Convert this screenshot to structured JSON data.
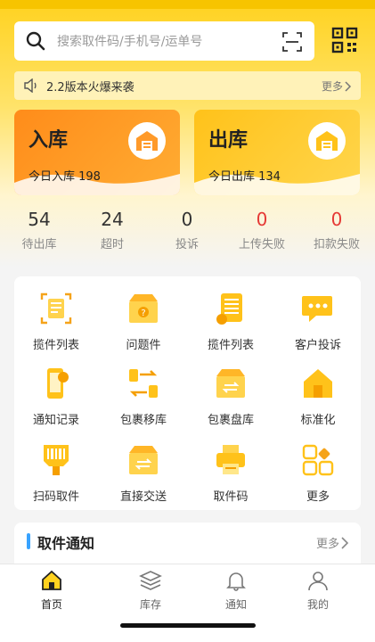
{
  "search": {
    "placeholder": "搜索取件码/手机号/运单号"
  },
  "notice": {
    "text": "2.2版本火爆来袭",
    "more": "更多"
  },
  "cards": {
    "in": {
      "title": "入库",
      "sub": "今日入库 198"
    },
    "out": {
      "title": "出库",
      "sub": "今日出库 134"
    }
  },
  "stats": [
    {
      "value": "54",
      "label": "待出库"
    },
    {
      "value": "24",
      "label": "超时"
    },
    {
      "value": "0",
      "label": "投诉"
    },
    {
      "value": "0",
      "label": "上传失败"
    },
    {
      "value": "0",
      "label": "扣款失败"
    }
  ],
  "grid": [
    {
      "label": "揽件列表",
      "icon": "list-scan-icon"
    },
    {
      "label": "问题件",
      "icon": "problem-package-icon"
    },
    {
      "label": "揽件列表",
      "icon": "document-list-icon"
    },
    {
      "label": "客户投诉",
      "icon": "chat-bubble-icon"
    },
    {
      "label": "通知记录",
      "icon": "phone-notify-icon"
    },
    {
      "label": "包裹移库",
      "icon": "transfer-icon"
    },
    {
      "label": "包裹盘库",
      "icon": "inventory-box-icon"
    },
    {
      "label": "标准化",
      "icon": "house-icon"
    },
    {
      "label": "扫码取件",
      "icon": "barcode-scanner-icon"
    },
    {
      "label": "直接交送",
      "icon": "hand-over-box-icon"
    },
    {
      "label": "取件码",
      "icon": "printer-icon"
    },
    {
      "label": "更多",
      "icon": "more-grid-icon"
    }
  ],
  "pickup_notice": {
    "title": "取件通知",
    "more": "更多"
  },
  "tabs": [
    {
      "label": "首页",
      "icon": "home-icon",
      "active": true
    },
    {
      "label": "库存",
      "icon": "layers-icon",
      "active": false
    },
    {
      "label": "通知",
      "icon": "bell-icon",
      "active": false
    },
    {
      "label": "我的",
      "icon": "user-icon",
      "active": false
    }
  ],
  "colors": {
    "brand": "#ffd21f",
    "orange": "#ff8c1a",
    "red": "#e53935",
    "blue": "#38a3ff"
  }
}
